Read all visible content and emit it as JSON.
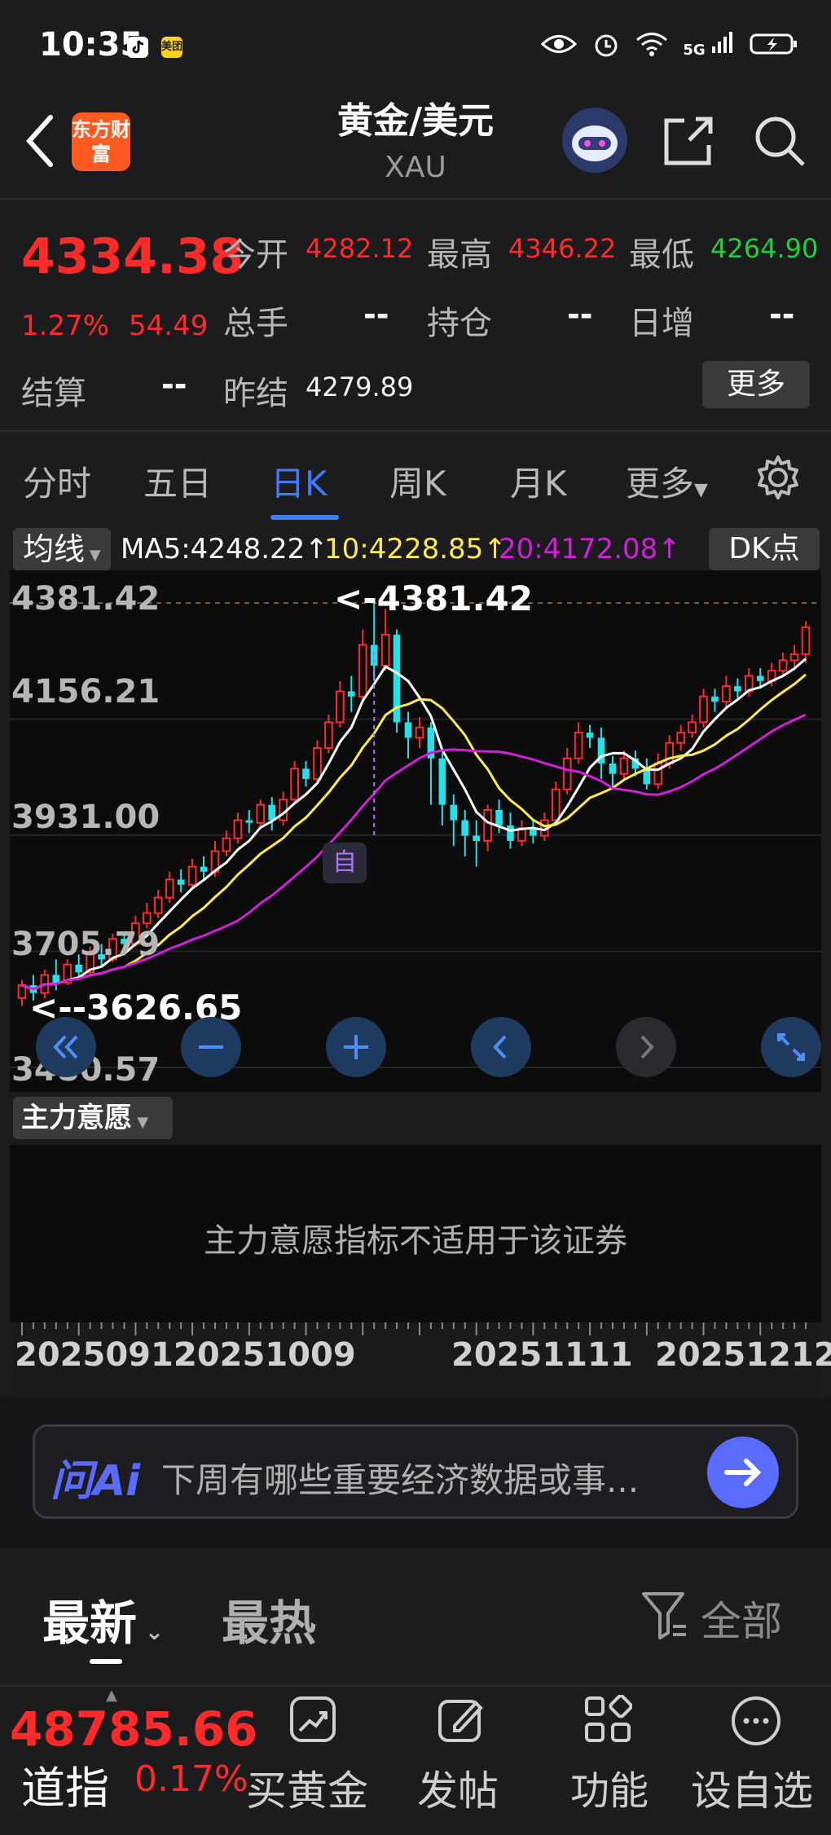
{
  "status_bar": {
    "time": "10:35",
    "app_icon_1": "tiktok-icon",
    "app_icon_2": "meituan-icon",
    "app_icon_2_text": "美团",
    "signal_text": "5G"
  },
  "header": {
    "title": "黄金/美元",
    "subtitle": "XAU",
    "logo_text": "东方财富"
  },
  "quote": {
    "price": "4334.38",
    "change_pct": "1.27%",
    "change": "54.49",
    "fields": [
      {
        "label": "今开",
        "value": "4282.12",
        "color": "#ff2a2a"
      },
      {
        "label": "最高",
        "value": "4346.22",
        "color": "#ff2a2a"
      },
      {
        "label": "最低",
        "value": "4264.90",
        "color": "#22d13a"
      },
      {
        "label": "总手",
        "value": "--",
        "color": "#ffffff"
      },
      {
        "label": "持仓",
        "value": "--",
        "color": "#ffffff"
      },
      {
        "label": "日增",
        "value": "--",
        "color": "#ffffff"
      },
      {
        "label": "结算",
        "value": "--",
        "color": "#ffffff"
      },
      {
        "label": "昨结",
        "value": "4279.89",
        "color": "#ffffff"
      }
    ],
    "more_label": "更多"
  },
  "tabs": [
    "分时",
    "五日",
    "日K",
    "周K",
    "月K",
    "更多"
  ],
  "active_tab": "日K",
  "indicators": {
    "ma_label": "均线",
    "ma5": "MA5:4248.22",
    "ma10": "10:4228.85",
    "ma20": "20:4172.08",
    "dk_label": "DK点"
  },
  "chart_labels": {
    "y_ticks": [
      "4381.42",
      "4156.21",
      "3931.00",
      "3705.79",
      "3480.57"
    ],
    "high_marker": "<-4381.42",
    "low_marker": "<--3626.65",
    "self_tag": "自"
  },
  "indicator_panel": {
    "selector": "主力意愿",
    "message": "主力意愿指标不适用于该证券"
  },
  "date_axis": [
    "20250912",
    "20251009",
    "20251111",
    "20251212"
  ],
  "ai_bar": {
    "logo": "问Ai",
    "placeholder": "下周有哪些重要经济数据或事..."
  },
  "news_tabs": {
    "latest": "最新",
    "hot": "最热",
    "filter": "全部"
  },
  "bottom_bar": {
    "index_value": "48785.66",
    "index_name": "道指",
    "index_pct": "0.17%",
    "items": [
      "买黄金",
      "发帖",
      "功能",
      "设自选"
    ]
  },
  "colors": {
    "up": "#ff2a2a",
    "down": "#22d13a",
    "candle_down": "#25e0e8",
    "accent": "#3e7bff",
    "ma5": "#ffffff",
    "ma10": "#ffe94f",
    "ma20": "#d020d8"
  },
  "chart_data": {
    "type": "candlestick",
    "title": "",
    "ylim": [
      3480.57,
      4381.42
    ],
    "y_ticks": [
      4381.42,
      4156.21,
      3931.0,
      3705.79,
      3480.57
    ],
    "x_ticks": [
      "20250912",
      "20251009",
      "20251111",
      "20251212"
    ],
    "candles": [
      [
        3615,
        3640,
        3600,
        3650
      ],
      [
        3640,
        3625,
        3610,
        3660
      ],
      [
        3625,
        3660,
        3615,
        3670
      ],
      [
        3660,
        3645,
        3630,
        3690
      ],
      [
        3645,
        3680,
        3640,
        3690
      ],
      [
        3680,
        3665,
        3650,
        3700
      ],
      [
        3665,
        3700,
        3660,
        3715
      ],
      [
        3700,
        3690,
        3675,
        3720
      ],
      [
        3690,
        3730,
        3685,
        3740
      ],
      [
        3730,
        3720,
        3705,
        3745
      ],
      [
        3720,
        3760,
        3715,
        3775
      ],
      [
        3760,
        3780,
        3750,
        3800
      ],
      [
        3780,
        3810,
        3770,
        3825
      ],
      [
        3810,
        3845,
        3800,
        3860
      ],
      [
        3845,
        3835,
        3820,
        3865
      ],
      [
        3835,
        3870,
        3830,
        3885
      ],
      [
        3870,
        3860,
        3845,
        3890
      ],
      [
        3860,
        3900,
        3850,
        3920
      ],
      [
        3900,
        3925,
        3890,
        3940
      ],
      [
        3925,
        3960,
        3915,
        3975
      ],
      [
        3960,
        3955,
        3935,
        3980
      ],
      [
        3955,
        3990,
        3945,
        4000
      ],
      [
        3990,
        3960,
        3940,
        4005
      ],
      [
        3960,
        4000,
        3950,
        4015
      ],
      [
        4000,
        4060,
        3995,
        4075
      ],
      [
        4060,
        4040,
        4025,
        4075
      ],
      [
        4040,
        4100,
        4035,
        4115
      ],
      [
        4100,
        4150,
        4090,
        4165
      ],
      [
        4150,
        4210,
        4140,
        4230
      ],
      [
        4210,
        4200,
        4170,
        4240
      ],
      [
        4200,
        4300,
        4195,
        4330
      ],
      [
        4300,
        4260,
        4230,
        4381.42
      ],
      [
        4260,
        4320,
        4250,
        4370
      ],
      [
        4320,
        4150,
        4130,
        4330
      ],
      [
        4150,
        4120,
        4080,
        4170
      ],
      [
        4120,
        4140,
        4100,
        4160
      ],
      [
        4140,
        4080,
        3990,
        4150
      ],
      [
        4080,
        3990,
        3950,
        4090
      ],
      [
        3990,
        3960,
        3910,
        4010
      ],
      [
        3960,
        3930,
        3890,
        3980
      ],
      [
        3930,
        3920,
        3870,
        3960
      ],
      [
        3920,
        3980,
        3900,
        3990
      ],
      [
        3980,
        3950,
        3935,
        4000
      ],
      [
        3950,
        3920,
        3905,
        3975
      ],
      [
        3920,
        3945,
        3910,
        3960
      ],
      [
        3945,
        3930,
        3915,
        3960
      ],
      [
        3930,
        3960,
        3920,
        3975
      ],
      [
        3960,
        4020,
        3950,
        4035
      ],
      [
        4020,
        4080,
        4010,
        4100
      ],
      [
        4080,
        4130,
        4070,
        4150
      ],
      [
        4130,
        4120,
        4100,
        4145
      ],
      [
        4120,
        4070,
        4040,
        4140
      ],
      [
        4070,
        4050,
        4020,
        4085
      ],
      [
        4050,
        4080,
        4040,
        4095
      ],
      [
        4080,
        4060,
        4045,
        4095
      ],
      [
        4060,
        4030,
        4020,
        4080
      ],
      [
        4030,
        4070,
        4020,
        4090
      ],
      [
        4070,
        4110,
        4060,
        4125
      ],
      [
        4110,
        4130,
        4095,
        4145
      ],
      [
        4130,
        4150,
        4120,
        4165
      ],
      [
        4150,
        4200,
        4140,
        4215
      ],
      [
        4200,
        4190,
        4170,
        4215
      ],
      [
        4190,
        4220,
        4180,
        4240
      ],
      [
        4220,
        4210,
        4195,
        4235
      ],
      [
        4210,
        4240,
        4200,
        4255
      ],
      [
        4240,
        4230,
        4215,
        4255
      ],
      [
        4230,
        4250,
        4220,
        4265
      ],
      [
        4250,
        4270,
        4240,
        4285
      ],
      [
        4270,
        4282,
        4255,
        4300
      ],
      [
        4282,
        4334.38,
        4264.9,
        4346.22
      ]
    ],
    "ma5_line": "MA5",
    "ma10_line": "10",
    "ma20_line": "20"
  }
}
